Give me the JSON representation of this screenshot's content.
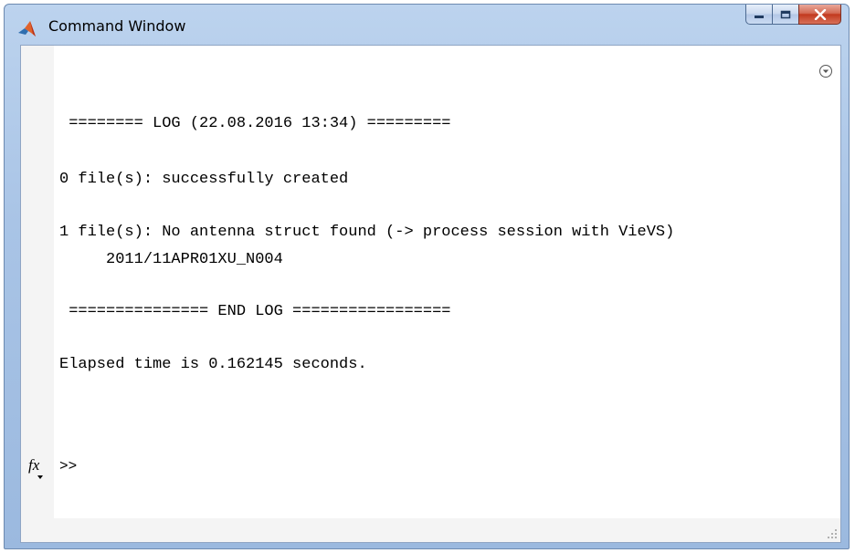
{
  "window": {
    "title": "Command Window",
    "controls": [
      "minimize-icon",
      "maximize-icon",
      "close-icon"
    ]
  },
  "console": {
    "lines": [
      " ======== LOG (22.08.2016 13:34) =========",
      "0 file(s): successfully created",
      "1 file(s): No antenna struct found (-> process session with VieVS)",
      "     2011/11APR01XU_N004",
      " =============== END LOG =================",
      "Elapsed time is 0.162145 seconds."
    ],
    "fx_label": "fx",
    "prompt": ">>"
  },
  "icons": {
    "app": "matlab-logo-icon",
    "actions_menu": "chevron-down-circle-icon",
    "resize": "resize-grip-icon"
  },
  "colors": {
    "titlebar": "#a9c4e6",
    "close_button": "#c2391e",
    "console_bg": "#ffffff",
    "text": "#000000"
  }
}
